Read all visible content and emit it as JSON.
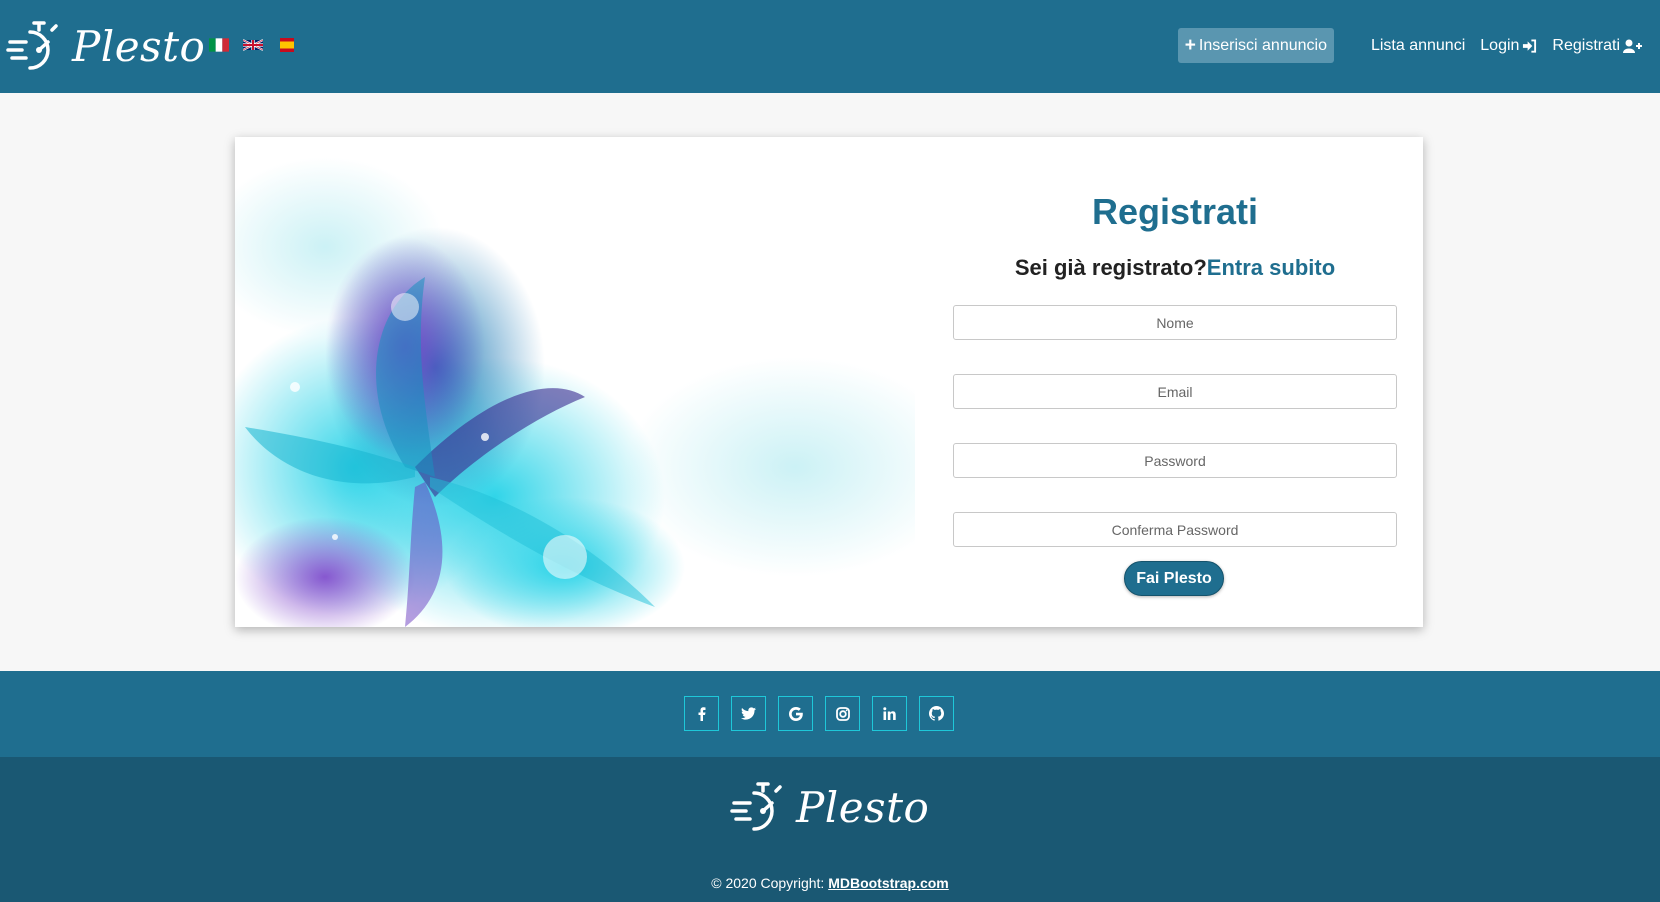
{
  "navbar": {
    "brand": "Plesto",
    "flags": [
      "flag-italy-icon",
      "flag-uk-icon",
      "flag-spain-icon"
    ],
    "insert_label": "Inserisci annuncio",
    "list_label": "Lista annunci",
    "login_label": "Login",
    "register_label": "Registrati"
  },
  "form": {
    "title": "Registrati",
    "already_text": "Sei già registrato?",
    "enter_link": "Entra subito",
    "name_placeholder": "Nome",
    "email_placeholder": "Email",
    "password_placeholder": "Password",
    "confirm_placeholder": "Conferma Password",
    "submit_label": "Fai Plesto"
  },
  "social": [
    "facebook-icon",
    "twitter-icon",
    "google-icon",
    "instagram-icon",
    "linkedin-icon",
    "github-icon"
  ],
  "footer": {
    "brand": "Plesto",
    "copyright_prefix": "© 2020 Copyright: ",
    "copyright_link": "MDBootstrap.com"
  },
  "colors": {
    "primary": "#1f6e8f",
    "footer_dark": "#1a5873",
    "social_border": "#1ec8d9"
  }
}
